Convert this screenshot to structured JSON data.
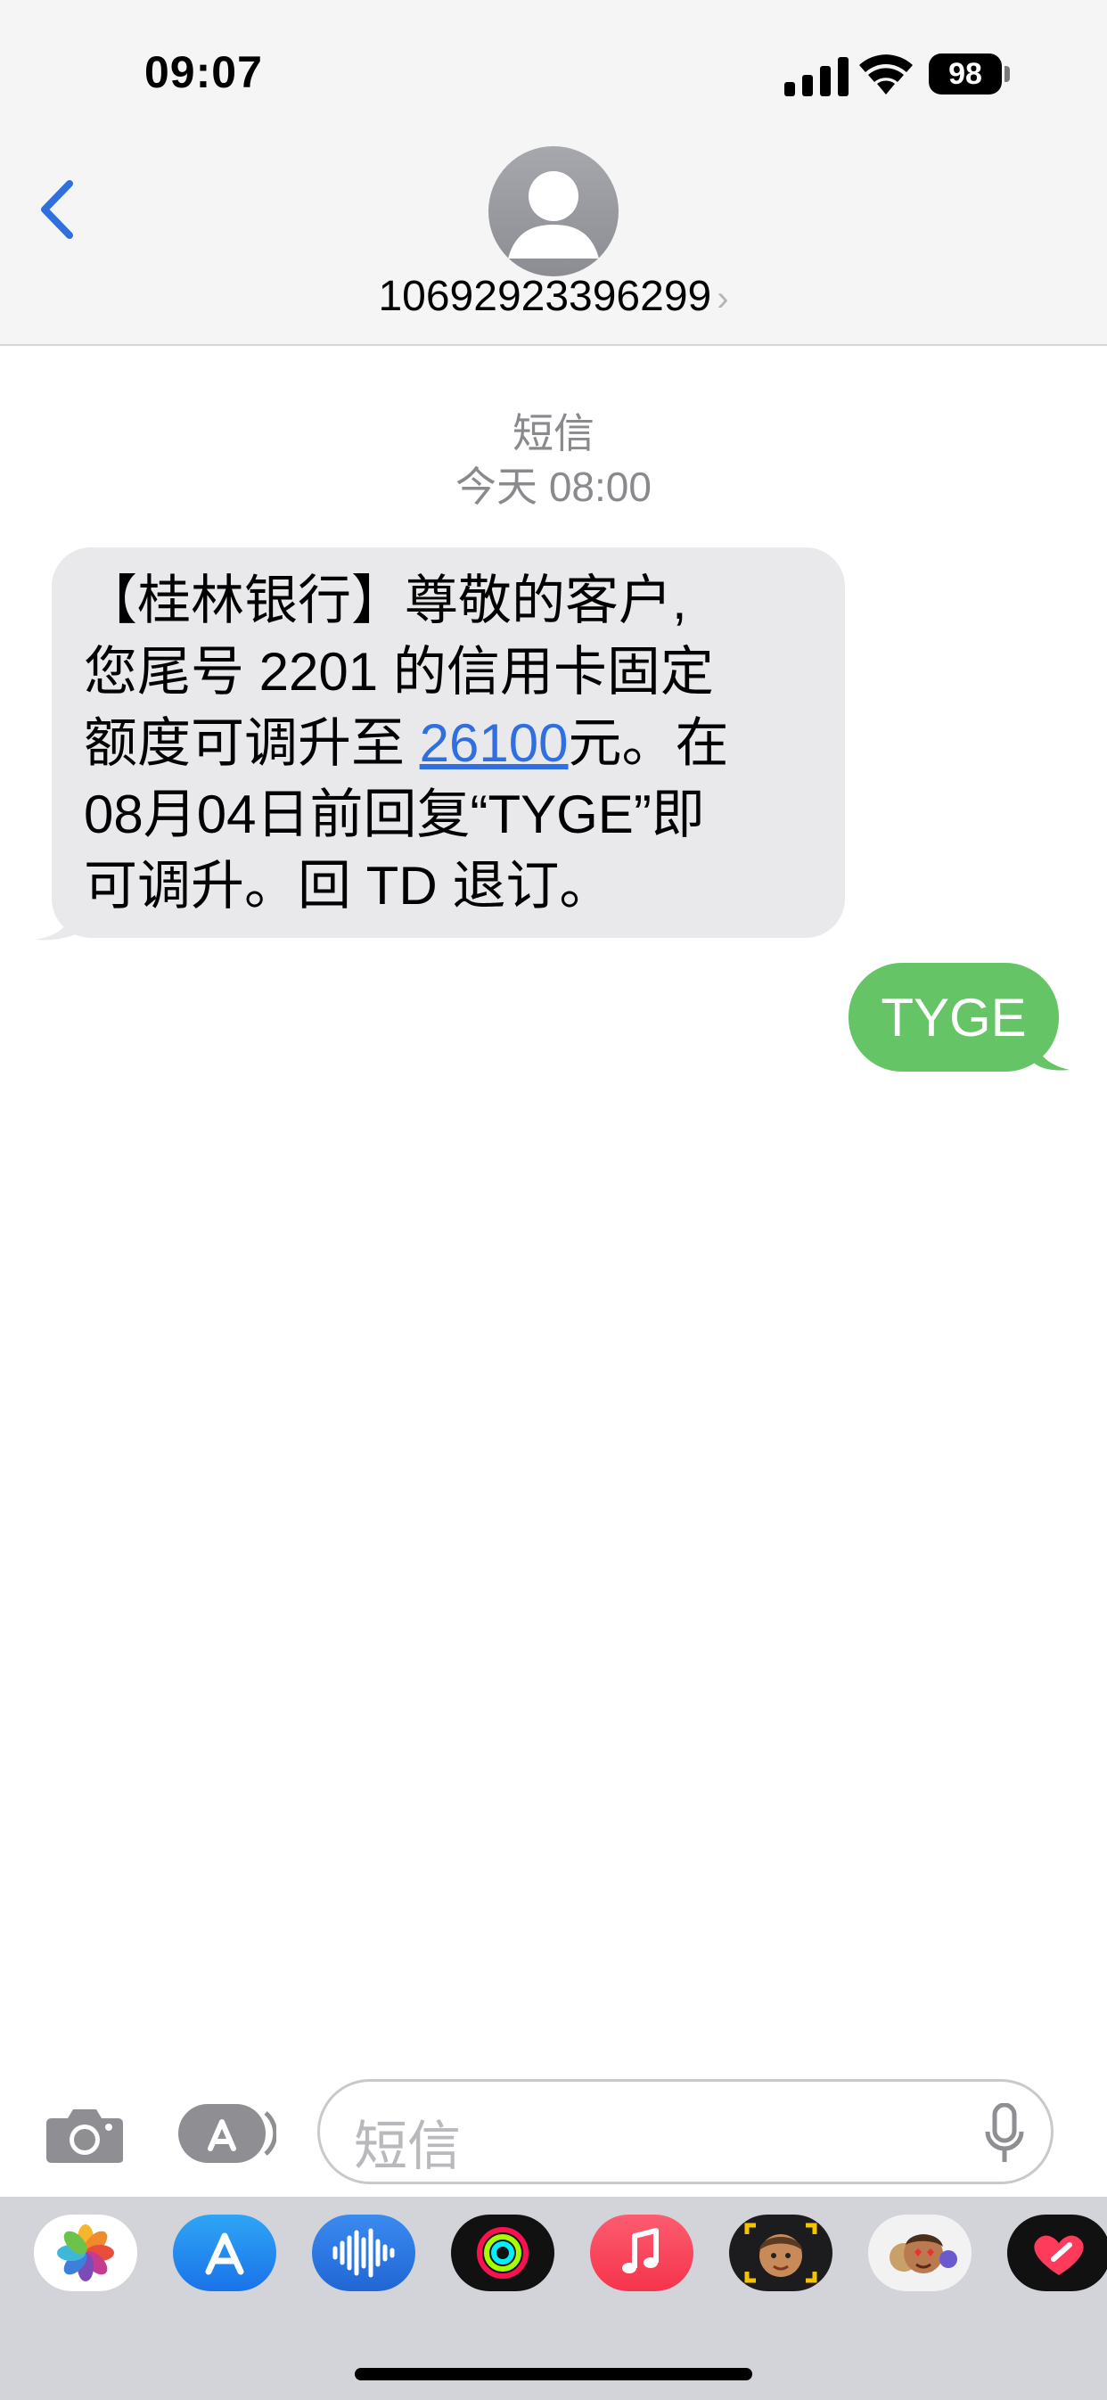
{
  "status_bar": {
    "time": "09:07",
    "battery": "98"
  },
  "header": {
    "contact_number": "10692923396299",
    "chevron": "›"
  },
  "thread": {
    "service_label": "短信",
    "timestamp": "今天 08:00",
    "incoming": {
      "line1": "【桂林银行】尊敬的客户,",
      "line2": "您尾号 2201 的信用卡固定",
      "line3_pre": "额度可调升至 ",
      "amount": "26100",
      "line3_post": "元。在",
      "line4": "08月04日前回复“TYGE”即",
      "line5": "可调升。回 TD 退订。"
    },
    "outgoing": {
      "text": "TYGE"
    }
  },
  "input_bar": {
    "placeholder": "短信"
  },
  "app_strip": {
    "apps": [
      "photos-icon",
      "app-store-icon",
      "audio-message-icon",
      "activity-icon",
      "music-icon",
      "memoji-icon",
      "memoji-stickers-icon",
      "digital-touch-icon"
    ]
  },
  "colors": {
    "accent": "#2f6fe0",
    "sms_green": "#65c466",
    "bubble_gray": "#e9e9eb"
  }
}
